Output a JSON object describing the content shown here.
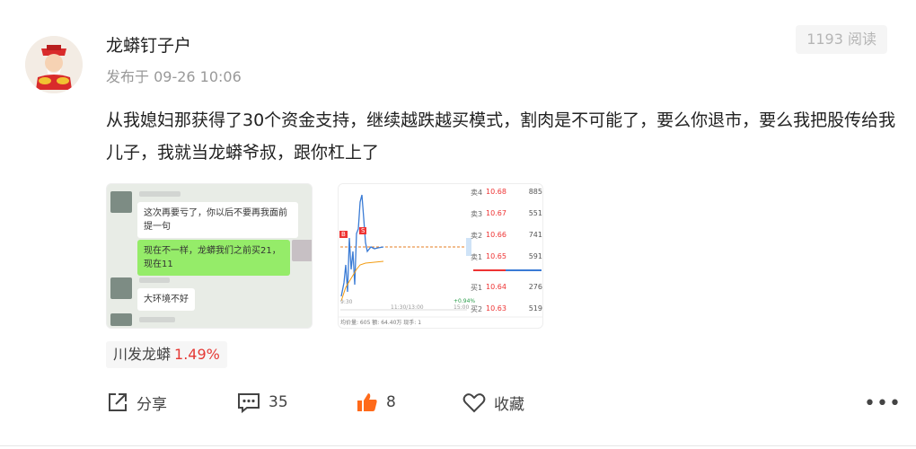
{
  "post": {
    "author": "龙蟒钉子户",
    "time": "发布于 09-26 10:06",
    "read_count": "1193 阅读",
    "content": "从我媳妇那获得了30个资金支持，继续越跌越买模式，割肉是不可能了，要么你退市，要么我把股传给我儿子，我就当龙蟒爷叔，跟你杠上了"
  },
  "chat_image": {
    "messages": [
      {
        "text": "这次再要亏了，你以后不要再我面前提一句",
        "side": "left"
      },
      {
        "text": "现在不一样，龙蟒我们之前买21，现在11",
        "side": "right"
      },
      {
        "text": "大环境不好",
        "side": "left"
      }
    ]
  },
  "chart_image": {
    "orderbook": [
      {
        "level": "卖4",
        "price": "10.68",
        "volume": "885"
      },
      {
        "level": "卖3",
        "price": "10.67",
        "volume": "551"
      },
      {
        "level": "卖2",
        "price": "10.66",
        "volume": "741"
      },
      {
        "level": "卖1",
        "price": "10.65",
        "volume": "591"
      },
      {
        "level": "买1",
        "price": "10.64",
        "volume": "276"
      },
      {
        "level": "买2",
        "price": "10.63",
        "volume": "519"
      }
    ],
    "change_label": "+0.94%",
    "time_start": "9:30",
    "time_mid": "11:30/13:00",
    "time_end": "15:00",
    "footer": "均价量: 605 额: 64.40万 现手: 1",
    "marker_b": "B",
    "marker_s": "S"
  },
  "stock_tag": {
    "name": "川发龙蟒",
    "change": "1.49%",
    "change_color": "#e53935"
  },
  "actions": {
    "share_label": "分享",
    "comment_count": "35",
    "like_count": "8",
    "favorite_label": "收藏",
    "more_label": "•••"
  },
  "colors": {
    "like_orange": "#ff6a1a",
    "rise_red": "#e33333",
    "icon_gray": "#444444"
  }
}
